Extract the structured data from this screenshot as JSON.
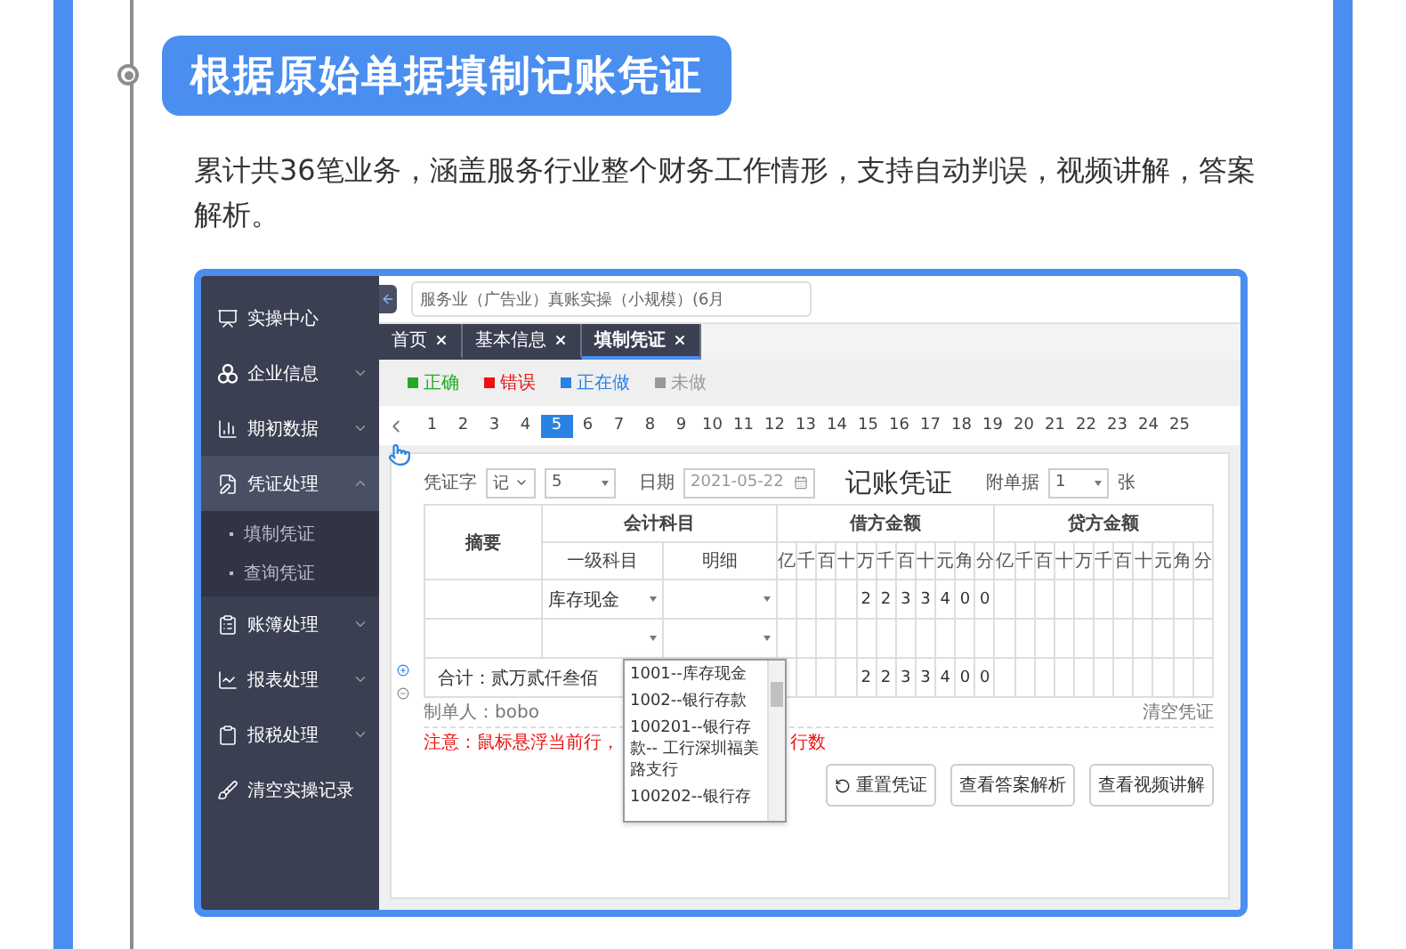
{
  "heading": {
    "title": "根据原始单据填制记账凭证",
    "description": "累计共36笔业务，涵盖服务行业整个财务工作情形，支持自动判误，视频讲解，答案解析。"
  },
  "app": {
    "sidebar": {
      "items": [
        {
          "label": "实操中心",
          "selected": false
        },
        {
          "label": "企业信息",
          "expanded": false,
          "selected": false
        },
        {
          "label": "期初数据",
          "expanded": false,
          "selected": false
        },
        {
          "label": "凭证处理",
          "expanded": true,
          "selected": true,
          "children": [
            {
              "label": "填制凭证"
            },
            {
              "label": "查询凭证"
            }
          ]
        },
        {
          "label": "账簿处理",
          "expanded": false,
          "selected": false
        },
        {
          "label": "报表处理",
          "expanded": false,
          "selected": false
        },
        {
          "label": "报税处理",
          "expanded": false,
          "selected": false
        },
        {
          "label": "清空实操记录",
          "selected": false
        }
      ]
    },
    "course_field": {
      "value": "服务业（广告业）真账实操（小规模）(6月"
    },
    "tabs": [
      {
        "label": "首页",
        "selected": false
      },
      {
        "label": "基本信息",
        "selected": false
      },
      {
        "label": "填制凭证",
        "selected": true
      }
    ],
    "legend": [
      {
        "label": "正确",
        "color": "#22aa22"
      },
      {
        "label": "错误",
        "color": "#ee1111"
      },
      {
        "label": "正在做",
        "color": "#2a82e4"
      },
      {
        "label": "未做",
        "color": "#999999"
      }
    ],
    "pages": [
      {
        "label": "1",
        "selected": false
      },
      {
        "label": "2",
        "selected": false
      },
      {
        "label": "3",
        "selected": false
      },
      {
        "label": "4",
        "selected": false
      },
      {
        "label": "5",
        "selected": true
      },
      {
        "label": "6",
        "selected": false
      },
      {
        "label": "7",
        "selected": false
      },
      {
        "label": "8",
        "selected": false
      },
      {
        "label": "9",
        "selected": false
      },
      {
        "label": "10",
        "selected": false
      },
      {
        "label": "11",
        "selected": false
      },
      {
        "label": "12",
        "selected": false
      },
      {
        "label": "13",
        "selected": false
      },
      {
        "label": "14",
        "selected": false
      },
      {
        "label": "15",
        "selected": false
      },
      {
        "label": "16",
        "selected": false
      },
      {
        "label": "17",
        "selected": false
      },
      {
        "label": "18",
        "selected": false
      },
      {
        "label": "19",
        "selected": false
      },
      {
        "label": "20",
        "selected": false
      },
      {
        "label": "21",
        "selected": false
      },
      {
        "label": "22",
        "selected": false
      },
      {
        "label": "23",
        "selected": false
      },
      {
        "label": "24",
        "selected": false
      },
      {
        "label": "25",
        "selected": false
      }
    ],
    "voucher": {
      "word_label": "凭证字",
      "word_value": "记",
      "number_value": "5",
      "date_label": "日期",
      "date_value": "2021-05-22",
      "title": "记账凭证",
      "attachments_label": "附单据",
      "attachments_value": "1",
      "attachments_unit": "张",
      "columns": {
        "summary": "摘要",
        "account": "会计科目",
        "level1": "一级科目",
        "detail": "明细",
        "debit": "借方金额",
        "credit": "贷方金额",
        "debit_digits": [
          "亿",
          "千",
          "百",
          "十",
          "万",
          "千",
          "百",
          "十",
          "元",
          "角",
          "分"
        ],
        "credit_digits": [
          "亿",
          "千",
          "百",
          "十",
          "万",
          "千",
          "百",
          "十",
          "元",
          "角",
          "分"
        ]
      },
      "rows": [
        {
          "account": "库存现金",
          "debit_digits": [
            "2",
            "2",
            "3",
            "3",
            "4",
            "0",
            "0"
          ]
        },
        {}
      ],
      "total": {
        "label": "合计：贰万贰仟叁佰",
        "debit_digits": [
          "2",
          "2",
          "3",
          "3",
          "4",
          "0",
          "0"
        ]
      },
      "dropdown": [
        "1001--库存现金",
        "1002--银行存款",
        "100201--银行存款-- 工行深圳福美路支行",
        "100202--银行存"
      ],
      "maker": "制单人：bobo",
      "clear_link": "清空凭证",
      "note_start": "注意：鼠标悬浮当前行，",
      "note_end": "行数",
      "buttons": [
        "重置凭证",
        "查看答案解析",
        "查看视频讲解"
      ]
    }
  }
}
